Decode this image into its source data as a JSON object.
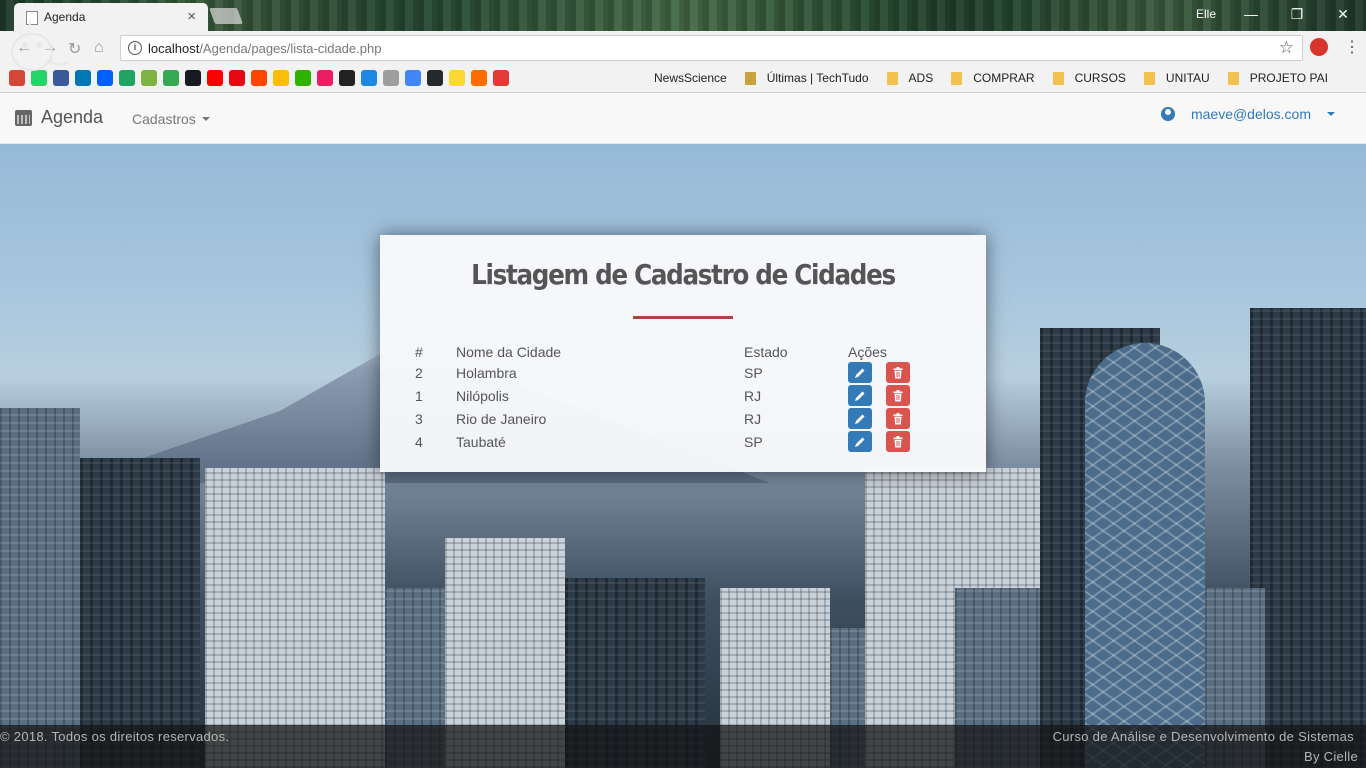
{
  "browser": {
    "tab_title": "Agenda",
    "tab_close": "×",
    "profile_name": "Elle",
    "window_buttons": [
      "—",
      "❐",
      "✕"
    ],
    "url_host": "localhost",
    "url_path": "/Agenda/pages/lista-cidade.php",
    "bookmark_icon_colors": [
      "#d44638",
      "#25d366",
      "#3b5998",
      "#0077b5",
      "#0061fe",
      "#1fa463",
      "#7cb342",
      "#34a853",
      "#171a21",
      "#ff0000",
      "#e50914",
      "#ff4500",
      "#fbbc05",
      "#2db300",
      "#e91e63",
      "#222222",
      "#1e88e5",
      "#9e9e9e",
      "#4285f4",
      "#24292e",
      "#fdd835",
      "#ff6d00",
      "#e53935"
    ],
    "bookmarks": [
      "NewsScience",
      "Últimas | TechTudo",
      "ADS",
      "COMPRAR",
      "CURSOS",
      "UNITAU",
      "PROJETO PAI"
    ]
  },
  "navbar": {
    "brand": "Agenda",
    "menu_cadastros": "Cadastros",
    "user_email": "maeve@delos.com"
  },
  "card": {
    "title": "Listagem de Cadastro de Cidades",
    "columns": [
      "#",
      "Nome da Cidade",
      "Estado",
      "Ações"
    ],
    "rows": [
      {
        "id": "2",
        "city": "Holambra",
        "state": "SP"
      },
      {
        "id": "1",
        "city": "Nilópolis",
        "state": "RJ"
      },
      {
        "id": "3",
        "city": "Rio de Janeiro",
        "state": "RJ"
      },
      {
        "id": "4",
        "city": "Taubaté",
        "state": "SP"
      }
    ]
  },
  "footer": {
    "copyright": "© 2018. Todos os direitos reservados.",
    "course": "Curso de Análise e Desenvolvimento de Sistemas",
    "byline": "By Cielle"
  },
  "colors": {
    "primary": "#337ab7",
    "danger": "#d9534f",
    "title_underline": "#a94442"
  }
}
